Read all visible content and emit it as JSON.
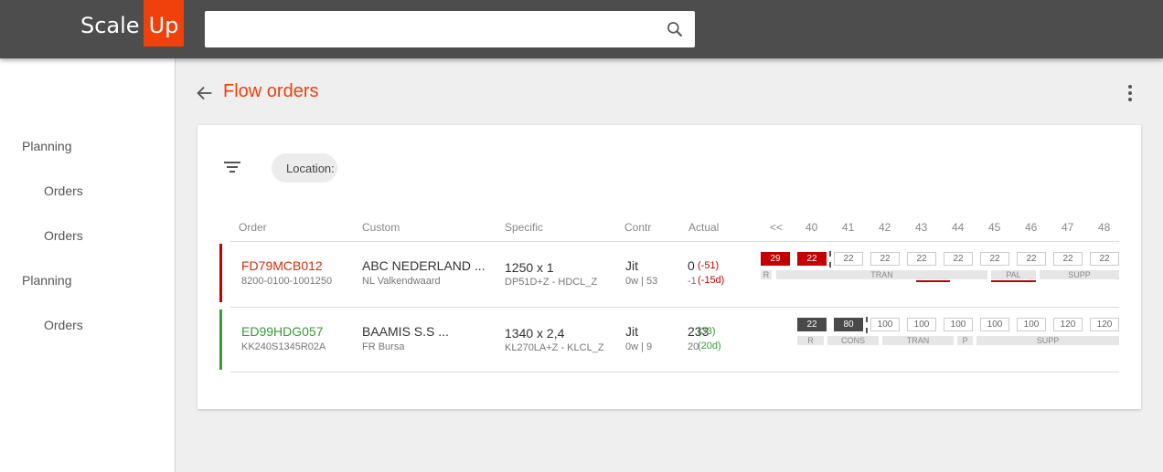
{
  "app": {
    "logo_scale": "Scale",
    "logo_up": "Up",
    "brand_color": "#f0400c"
  },
  "search": {
    "placeholder": "",
    "icon": "search-icon"
  },
  "sidebar": {
    "items": [
      {
        "label": "Planning"
      },
      {
        "label": "Orders"
      },
      {
        "label": "Orders"
      },
      {
        "label": "Planning"
      },
      {
        "label": "Orders"
      }
    ]
  },
  "header": {
    "title": "Flow orders",
    "back_icon": "arrow-back-icon",
    "more_icon": "more-vert-icon"
  },
  "filters": {
    "icon": "filter-icon",
    "chip_label": "Location:"
  },
  "table": {
    "columns": [
      "Order",
      "Custom",
      "Specific",
      "Contr",
      "Actual"
    ],
    "week_nav": "<<",
    "weeks": [
      "40",
      "41",
      "42",
      "43",
      "44",
      "45",
      "46",
      "47",
      "48"
    ],
    "rows": [
      {
        "status_color": "#c40000",
        "order": "FD79MCB012",
        "order_sub": "8200-0100-1001250",
        "customer": "ABC NEDERLAND ...",
        "customer_sub": "NL Valkendwaard",
        "spec": "1250 x 1",
        "spec_sub": "DP51D+Z - HDCL_Z",
        "contract": "Jit",
        "contract_sub": "0w | 53",
        "actual": "0",
        "actual_delta": "(-51)",
        "actual_sub": "-1",
        "actual_sub_delta": "(-15d)",
        "week_values": [
          "29",
          "22",
          "22",
          "22",
          "22",
          "22",
          "22",
          "22",
          "22",
          "22"
        ],
        "segments": [
          "R",
          "TRAN",
          "PAL",
          "SUPP"
        ]
      },
      {
        "status_color": "#3a9a3a",
        "order": "ED99HDG057",
        "order_sub": "KK240S1345R02A",
        "customer": "BAAMIS  S.S ...",
        "customer_sub": "FR Bursa",
        "spec": "1340 x 2,4",
        "spec_sub": "KL270LA+Z - KLCL_Z",
        "contract": "Jit",
        "contract_sub": "0w | 9",
        "actual": "233",
        "actual_delta": "(33)",
        "actual_sub": "20",
        "actual_sub_delta": "(20d)",
        "week_values": [
          "22",
          "80",
          "100",
          "100",
          "100",
          "100",
          "100",
          "120",
          "120"
        ],
        "segments": [
          "R",
          "CONS",
          "TRAN",
          "P",
          "SUPP"
        ]
      }
    ]
  }
}
